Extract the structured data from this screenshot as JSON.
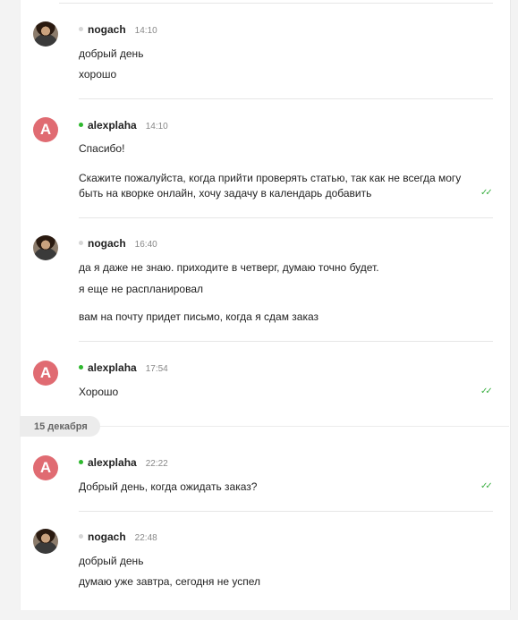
{
  "messages": [
    {
      "author": "nogach",
      "time": "14:10",
      "avatar": "photo",
      "online": false,
      "lines": [
        "добрый день",
        "хорошо"
      ],
      "read": false
    },
    {
      "author": "alexplaha",
      "time": "14:10",
      "avatar": "A",
      "online": true,
      "lines": [
        "Спасибо!",
        "Скажите пожалуйста, когда прийти проверять статью, так как не всегда могу быть на кворке онлайн, хочу задачу в календарь добавить"
      ],
      "read": true
    },
    {
      "author": "nogach",
      "time": "16:40",
      "avatar": "photo",
      "online": false,
      "lines": [
        "да я даже не знаю. приходите в четверг, думаю точно будет.",
        "я еще не распланировал",
        "вам на почту придет письмо, когда я сдам заказ"
      ],
      "read": false
    },
    {
      "author": "alexplaha",
      "time": "17:54",
      "avatar": "A",
      "online": true,
      "lines": [
        "Хорошо"
      ],
      "read": true
    },
    {
      "author": "alexplaha",
      "time": "22:22",
      "avatar": "A",
      "online": true,
      "lines": [
        "Добрый день, когда ожидать заказ?"
      ],
      "read": true
    },
    {
      "author": "nogach",
      "time": "22:48",
      "avatar": "photo",
      "online": false,
      "lines": [
        "добрый день",
        "думаю уже завтра, сегодня не успел"
      ],
      "read": false
    }
  ],
  "date_divider": "15 декабря",
  "read_mark": "✓✓",
  "colors": {
    "online": "#2eb82e",
    "offline": "#d6d6d6",
    "avatar_letter_bg": "#e06b72",
    "read_check": "#3cb043"
  }
}
